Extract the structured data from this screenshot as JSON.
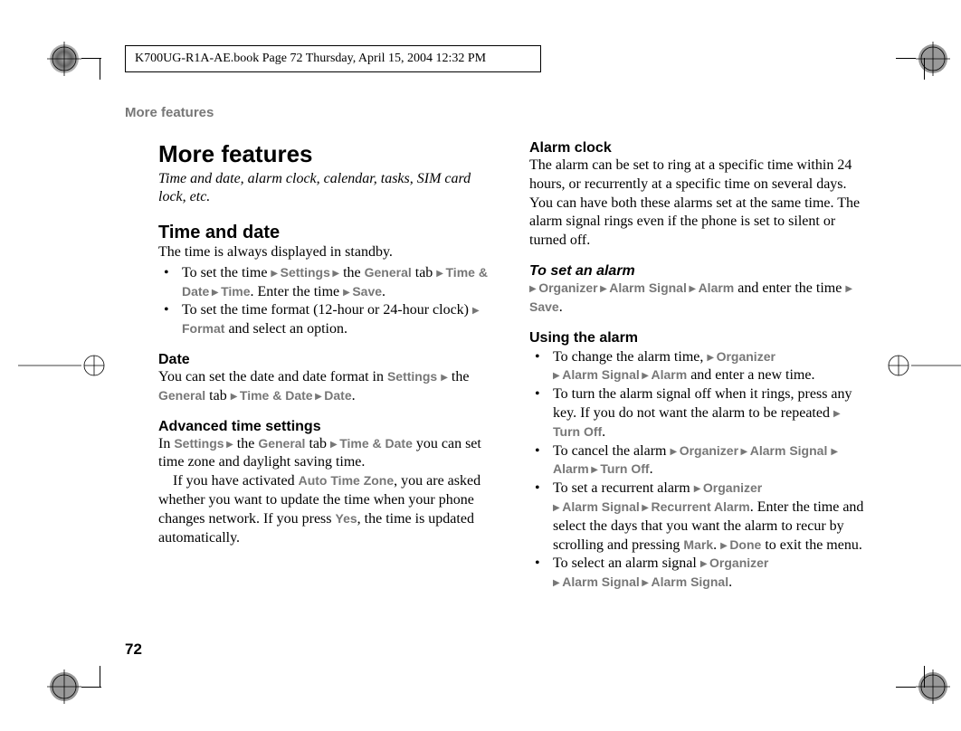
{
  "header": {
    "text": "K700UG-R1A-AE.book  Page 72  Thursday, April 15, 2004  12:32 PM"
  },
  "running_head": "More features",
  "page_number": "72",
  "left": {
    "title": "More features",
    "subtitle": "Time and date, alarm clock, calendar, tasks, SIM card lock, etc.",
    "time_date_heading": "Time and date",
    "time_intro": "The time is always displayed in standby.",
    "bullet1_a": "To set the time ",
    "bullet1_b": "Settings",
    "bullet1_c": " the ",
    "bullet1_d": "General",
    "bullet1_e": " tab ",
    "bullet1_f": "Time & Date",
    "bullet1_g": "Time",
    "bullet1_h": ". Enter the time ",
    "bullet1_i": "Save",
    "bullet2_a": "To set the time format (12-hour or 24-hour clock) ",
    "bullet2_b": "Format",
    "bullet2_c": " and select an option.",
    "date_heading": "Date",
    "date_text_a": "You can set the date and date format in ",
    "date_text_settings": "Settings",
    "date_text_the": " the ",
    "date_text_general": "General",
    "date_text_tab": " tab ",
    "date_text_td": "Time & Date",
    "date_text_date": "Date",
    "adv_heading": "Advanced time settings",
    "adv_a": "In ",
    "adv_settings": "Settings",
    "adv_the": " the ",
    "adv_general": "General",
    "adv_tab": " tab ",
    "adv_td": "Time & Date",
    "adv_b": " you can set time zone and daylight saving time.",
    "adv_c": "If you have activated ",
    "adv_atz": "Auto Time Zone",
    "adv_d": ", you are asked whether you want to update the time when your phone changes network. If you press ",
    "adv_yes": "Yes",
    "adv_e": ", the time is updated automatically."
  },
  "right": {
    "alarm_heading": "Alarm clock",
    "alarm_intro": "The alarm can be set to ring at a specific time within 24 hours, or recurrently at a specific time on several days. You can have both these alarms set at the same time. The alarm signal rings even if the phone is set to silent or turned off.",
    "set_alarm_heading": "To set an alarm",
    "set_a": "Organizer",
    "set_b": "Alarm Signal",
    "set_c": "Alarm",
    "set_d": " and enter the time ",
    "set_e": "Save",
    "using_heading": "Using the alarm",
    "u1_a": "To change the alarm time, ",
    "u1_org": "Organizer",
    "u1_as": "Alarm Signal",
    "u1_al": "Alarm",
    "u1_b": " and enter a new time.",
    "u2_a": "To turn the alarm signal off when it rings, press any key. If you do not want the alarm to be repeated ",
    "u2_to": "Turn Off",
    "u3_a": "To cancel the alarm ",
    "u3_org": "Organizer",
    "u3_as": "Alarm Signal",
    "u3_al": "Alarm",
    "u3_to": "Turn Off",
    "u4_a": "To set a recurrent alarm ",
    "u4_org": "Organizer",
    "u4_as": "Alarm Signal",
    "u4_ra": "Recurrent Alarm",
    "u4_b": ". Enter the time and select the days that you want the alarm to recur by scrolling and pressing ",
    "u4_mark": "Mark",
    "u4_c": ". ",
    "u4_done": "Done",
    "u4_d": " to exit the menu.",
    "u5_a": "To select an alarm signal ",
    "u5_org": "Organizer",
    "u5_as": "Alarm Signal",
    "u5_as2": "Alarm Signal"
  }
}
